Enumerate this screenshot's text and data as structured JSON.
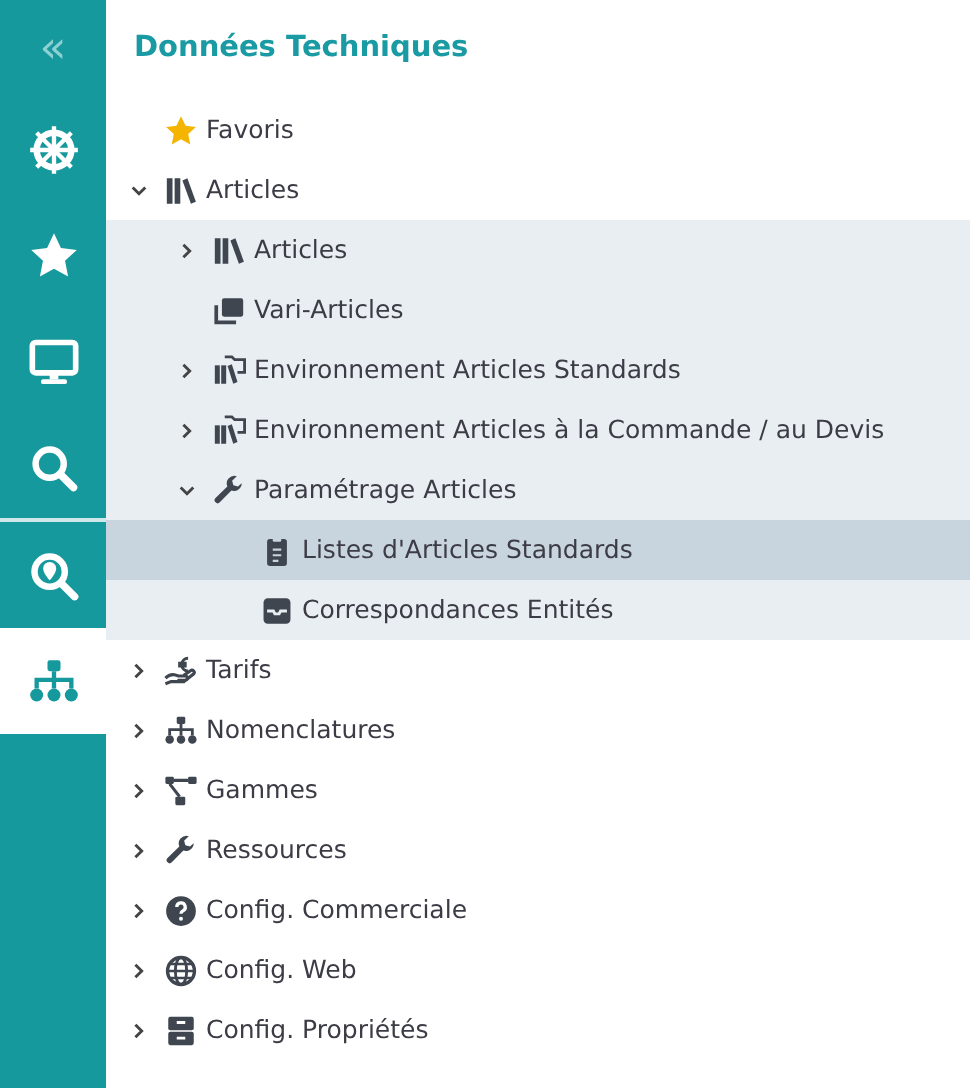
{
  "sidebar": {
    "collapse_label": "«",
    "items": [
      {
        "kind": "wheel",
        "selected": false
      },
      {
        "kind": "star",
        "selected": false
      },
      {
        "kind": "monitor",
        "selected": false
      },
      {
        "kind": "search",
        "selected": false
      },
      {
        "kind": "map-search",
        "selected": false
      },
      {
        "kind": "sitemap",
        "selected": true
      }
    ]
  },
  "panel": {
    "title": "Données Techniques"
  },
  "tree": [
    {
      "label": "Favoris",
      "kind": "star",
      "selected": false
    },
    {
      "label": "Articles",
      "kind": "books",
      "expanded": true,
      "selected": false,
      "children": [
        {
          "label": "Articles",
          "kind": "books",
          "expanded": false,
          "selected": false
        },
        {
          "label": "Vari-Articles",
          "kind": "stack",
          "selected": false
        },
        {
          "label": "Environnement Articles Standards",
          "kind": "books-folder",
          "expanded": false,
          "selected": false
        },
        {
          "label": "Environnement Articles à la Commande / au Devis",
          "kind": "books-folder",
          "expanded": false,
          "selected": false
        },
        {
          "label": "Paramétrage Articles",
          "kind": "wrench",
          "expanded": true,
          "selected": false,
          "children": [
            {
              "label": "Listes d'Articles Standards",
              "kind": "clipboard",
              "selected": true
            },
            {
              "label": "Correspondances Entités",
              "kind": "tray",
              "selected": false
            }
          ]
        }
      ]
    },
    {
      "label": "Tarifs",
      "kind": "hand-euro",
      "expanded": false,
      "selected": false
    },
    {
      "label": "Nomenclatures",
      "kind": "sitemap",
      "expanded": false,
      "selected": false
    },
    {
      "label": "Gammes",
      "kind": "nodes",
      "expanded": false,
      "selected": false
    },
    {
      "label": "Ressources",
      "kind": "wrench",
      "expanded": false,
      "selected": false
    },
    {
      "label": "Config. Commerciale",
      "kind": "question",
      "expanded": false,
      "selected": false
    },
    {
      "label": "Config. Web",
      "kind": "globe",
      "expanded": false,
      "selected": false
    },
    {
      "label": "Config. Propriétés",
      "kind": "cabinet",
      "expanded": false,
      "selected": false
    }
  ]
}
